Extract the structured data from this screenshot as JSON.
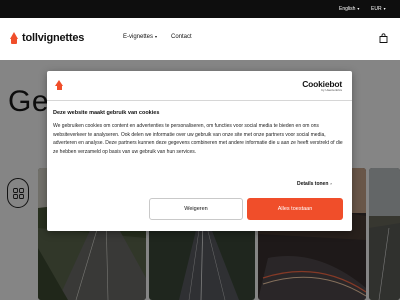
{
  "topbar": {
    "language": "English",
    "currency": "EUR"
  },
  "header": {
    "logo_text": "tollvignettes",
    "nav": {
      "evignettes": "E-vignettes",
      "contact": "Contact"
    }
  },
  "hero": {
    "title_fragment": "Get"
  },
  "cookie_dialog": {
    "brand": "Cookiebot",
    "brand_by": "by Usercentrics",
    "title": "Deze website maakt gebruik van cookies",
    "body": "We gebruiken cookies om content en advertenties te personaliseren, om functies voor social media te bieden en om ons websiteverkeer te analyseren. Ook delen we informatie over uw gebruik van onze site met onze partners voor social media, adverteren en analyse. Deze partners kunnen deze gegevens combineren met andere informatie die u aan ze heeft verstrekt of die ze hebben verzameld op basis van uw gebruik van hun services.",
    "details_label": "Details tonen",
    "decline_label": "Weigeren",
    "accept_label": "Alles toestaan"
  },
  "colors": {
    "accent": "#f04e2a",
    "topbar": "#0e0e0e"
  },
  "icons": [
    "chevron-down-icon",
    "cart-icon",
    "grid-icon",
    "chevron-right-icon"
  ]
}
